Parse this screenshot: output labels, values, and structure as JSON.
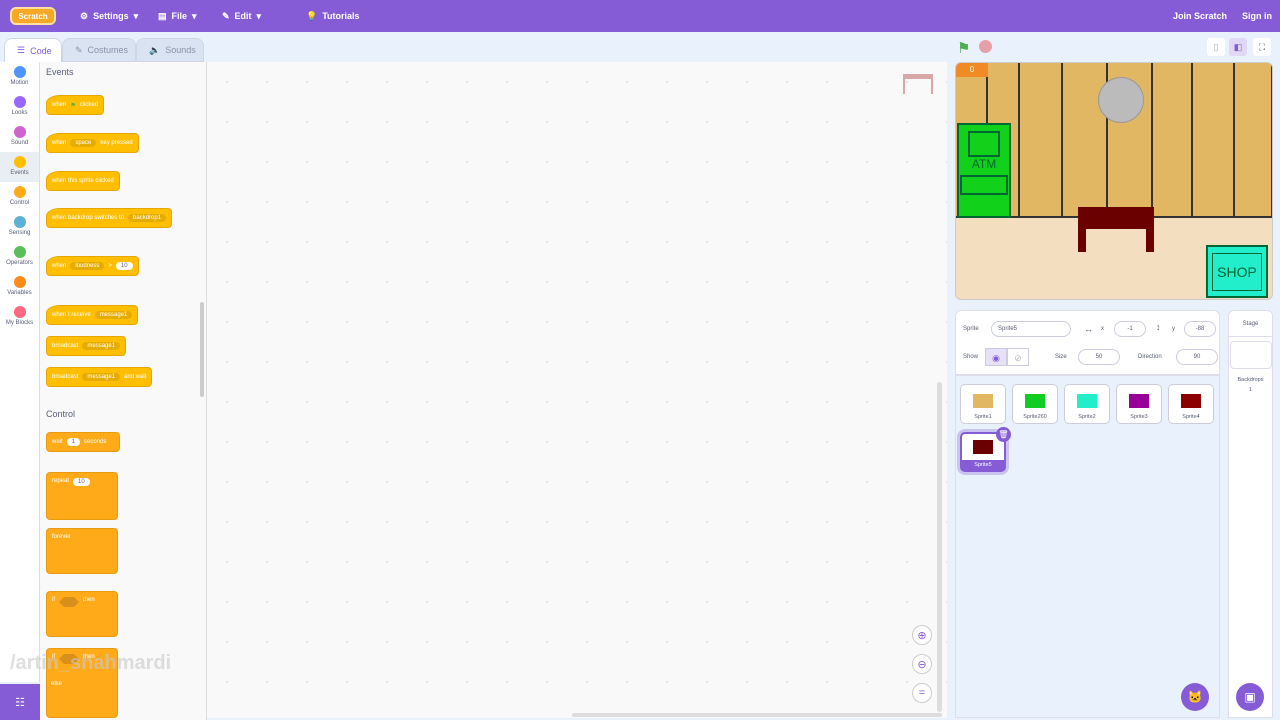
{
  "menu": {
    "logo": "Scratch",
    "settings": "Settings",
    "file": "File",
    "edit": "Edit",
    "tutorials": "Tutorials",
    "join": "Join Scratch",
    "signin": "Sign in"
  },
  "tabs": {
    "code": "Code",
    "costumes": "Costumes",
    "sounds": "Sounds"
  },
  "categories": [
    {
      "label": "Motion",
      "color": "#4c97ff"
    },
    {
      "label": "Looks",
      "color": "#9966ff"
    },
    {
      "label": "Sound",
      "color": "#cf63cf"
    },
    {
      "label": "Events",
      "color": "#ffbf00"
    },
    {
      "label": "Control",
      "color": "#ffab19"
    },
    {
      "label": "Sensing",
      "color": "#5cb1d6"
    },
    {
      "label": "Operators",
      "color": "#59c059"
    },
    {
      "label": "Variables",
      "color": "#ff8c1a"
    },
    {
      "label": "My Blocks",
      "color": "#ff6680"
    }
  ],
  "palette": {
    "events_title": "Events",
    "b1": {
      "a": "when",
      "b": "clicked"
    },
    "b2": {
      "a": "when",
      "drop": "space",
      "b": "key pressed"
    },
    "b3": {
      "a": "when this sprite clicked"
    },
    "b4": {
      "a": "when backdrop switches to",
      "drop": "backdrop1"
    },
    "b5": {
      "a": "when",
      "drop": "loudness",
      "op": ">",
      "num": "10"
    },
    "b6": {
      "a": "when I receive",
      "drop": "message1"
    },
    "b7": {
      "a": "broadcast",
      "drop": "message1"
    },
    "b8": {
      "a": "broadcast",
      "drop": "message1",
      "b": "and wait"
    },
    "control_title": "Control",
    "c1": {
      "a": "wait",
      "num": "1",
      "b": "seconds"
    },
    "c2": {
      "a": "repeat",
      "num": "10"
    },
    "c3": {
      "a": "forever"
    },
    "c4": {
      "a": "if",
      "b": "then"
    },
    "c5": {
      "a": "if",
      "b": "then",
      "c": "else"
    }
  },
  "watermark": "/artin_shahmardi",
  "stage": {
    "score": "0",
    "atm": "ATM",
    "shop": "SHOP"
  },
  "sprite_info": {
    "sprite_label": "Sprite",
    "name": "Sprite5",
    "x_label": "x",
    "x": "-1",
    "y_label": "y",
    "y": "-88",
    "show_label": "Show",
    "size_label": "Size",
    "size": "50",
    "direction_label": "Direction",
    "direction": "90"
  },
  "sprites": [
    {
      "name": "Sprite1",
      "color": "#e2b764"
    },
    {
      "name": "Sprite260",
      "color": "#11cc22"
    },
    {
      "name": "Sprite2",
      "color": "#22eecc"
    },
    {
      "name": "Sprite3",
      "color": "#990099"
    },
    {
      "name": "Sprite4",
      "color": "#8b0000"
    },
    {
      "name": "Sprite5",
      "color": "#6b0000"
    }
  ],
  "stage_panel": {
    "title": "Stage",
    "backdrops_label": "Backdrops",
    "backdrops_count": "1"
  }
}
